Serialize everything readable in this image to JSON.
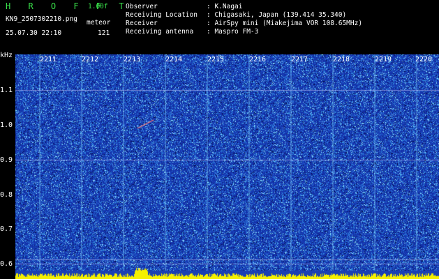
{
  "header": {
    "app_title": "H R O F F T",
    "version": "1.00f",
    "filename": "KN9_2507302210.png",
    "mode": "meteor",
    "datetime": "25.07.30 22:10",
    "count": "121",
    "info": [
      {
        "label": "Observer",
        "value": ": K.Nagai"
      },
      {
        "label": "Receiving Location",
        "value": ": Chigasaki, Japan (139.414 35.340)"
      },
      {
        "label": "Receiver",
        "value": ": AirSpy mini (Miakejima VOR 108.65MHz)"
      },
      {
        "label": "Receiving antenna",
        "value": ": Maspro FM-3"
      }
    ]
  },
  "waterfall": {
    "y_unit": "kHz",
    "y_ticks": [
      "1.1",
      "1.0",
      "0.9",
      "0.8",
      "0.7",
      "0.6"
    ],
    "x_ticks": [
      "2211",
      "2212",
      "2213",
      "2214",
      "2215",
      "2216",
      "2217",
      "2218",
      "2219",
      "2220"
    ],
    "colors": {
      "background": "#1a3fb3",
      "noise_light": "#3a8be0",
      "noise_bright": "#8fe6ff",
      "peak": "#f5f000",
      "grid": "#c8c8ff"
    }
  }
}
